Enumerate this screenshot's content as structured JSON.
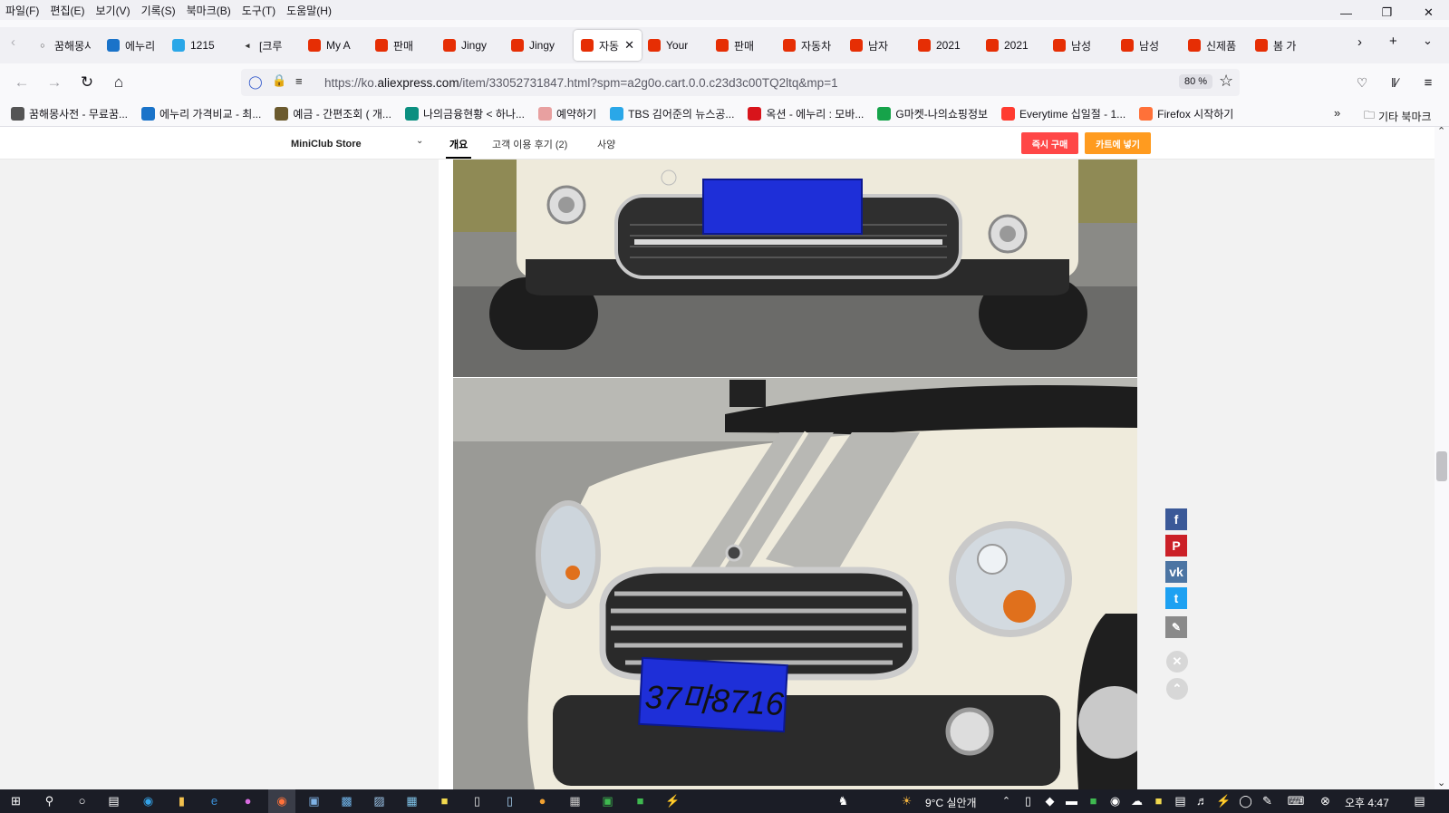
{
  "menubar": [
    "파일(F)",
    "편집(E)",
    "보기(V)",
    "기록(S)",
    "북마크(B)",
    "도구(T)",
    "도움말(H)"
  ],
  "tabs": [
    {
      "label": "꿈해몽사전",
      "icon": "globe-icon"
    },
    {
      "label": "에누리",
      "icon": "enuri-icon",
      "color": "#1a73c9"
    },
    {
      "label": "1215",
      "icon": "drop-icon",
      "color": "#2aa7e8"
    },
    {
      "label": "[크루",
      "icon": "speaker-muted-icon"
    },
    {
      "label": "My A",
      "icon": "aliexpress-icon",
      "color": "#e62e04"
    },
    {
      "label": "판매",
      "icon": "aliexpress-icon",
      "color": "#e62e04"
    },
    {
      "label": "Jingy",
      "icon": "aliexpress-icon",
      "color": "#e62e04"
    },
    {
      "label": "Jingy",
      "icon": "aliexpress-icon",
      "color": "#e62e04"
    },
    {
      "label": "자동",
      "icon": "aliexpress-icon",
      "color": "#e62e04",
      "active": true
    },
    {
      "label": "Your",
      "icon": "aliexpress-icon",
      "color": "#e62e04"
    },
    {
      "label": "판매",
      "icon": "aliexpress-icon",
      "color": "#e62e04"
    },
    {
      "label": "자동차",
      "icon": "aliexpress-icon",
      "color": "#e62e04"
    },
    {
      "label": "남자",
      "icon": "aliexpress-icon",
      "color": "#e62e04"
    },
    {
      "label": "2021",
      "icon": "aliexpress-icon",
      "color": "#e62e04"
    },
    {
      "label": "2021",
      "icon": "aliexpress-icon",
      "color": "#e62e04"
    },
    {
      "label": "남성",
      "icon": "aliexpress-icon",
      "color": "#e62e04"
    },
    {
      "label": "남성",
      "icon": "aliexpress-icon",
      "color": "#e62e04"
    },
    {
      "label": "신제품",
      "icon": "aliexpress-icon",
      "color": "#e62e04"
    },
    {
      "label": "봄 가",
      "icon": "aliexpress-icon",
      "color": "#e62e04"
    }
  ],
  "url": {
    "prefix": "https://ko.",
    "domain": "aliexpress.com",
    "path": "/item/33052731847.html?spm=a2g0o.cart.0.0.c23d3c00TQ2ltq&mp=1"
  },
  "zoom": "80 %",
  "bookmarks": [
    {
      "label": "꿈해몽사전 - 무료꿈...",
      "icon": "globe-icon",
      "color": "#555555"
    },
    {
      "label": "에누리 가격비교 - 최...",
      "icon": "enuri-icon",
      "color": "#1a73c9"
    },
    {
      "label": "예금 - 간편조회 ( 개...",
      "icon": "kb-icon",
      "color": "#6b5a2e"
    },
    {
      "label": "나의금융현황 < 하나...",
      "icon": "hana-icon",
      "color": "#0b8f80"
    },
    {
      "label": "예약하기",
      "icon": "calendar-icon",
      "color": "#e8a0a0"
    },
    {
      "label": "TBS 김어준의 뉴스공...",
      "icon": "drop-icon",
      "color": "#2aa7e8"
    },
    {
      "label": "옥션 - 에누리 : 모바...",
      "icon": "auction-icon",
      "color": "#d8141b"
    },
    {
      "label": "G마켓-나의쇼핑정보",
      "icon": "gmarket-icon",
      "color": "#16a34a"
    },
    {
      "label": "Everytime 십일절 - 1...",
      "icon": "11st-icon",
      "color": "#ff3b30"
    },
    {
      "label": "Firefox 시작하기",
      "icon": "firefox-icon",
      "color": "#ff7139"
    }
  ],
  "other_bookmarks": "기타 북마크",
  "store": {
    "name": "MiniClub Store",
    "tabs": [
      "개요",
      "고객 이용 후기 (2)",
      "사양"
    ],
    "buy_now": "즉시 구매",
    "add_to_cart": "카트에 넣기",
    "colors": {
      "buy": "#ff4747",
      "cart": "#ff9b1f"
    }
  },
  "plate_text": "37마8716",
  "share": [
    {
      "name": "facebook-share",
      "glyph": "f",
      "color": "#3b5998"
    },
    {
      "name": "pinterest-share",
      "glyph": "P",
      "color": "#cb2027"
    },
    {
      "name": "vk-share",
      "glyph": "vk",
      "color": "#4c75a3"
    },
    {
      "name": "twitter-share",
      "glyph": "t",
      "color": "#1da1f2"
    }
  ],
  "taskbar": {
    "weather": "9°C 실안개",
    "time": "오후 4:47"
  }
}
